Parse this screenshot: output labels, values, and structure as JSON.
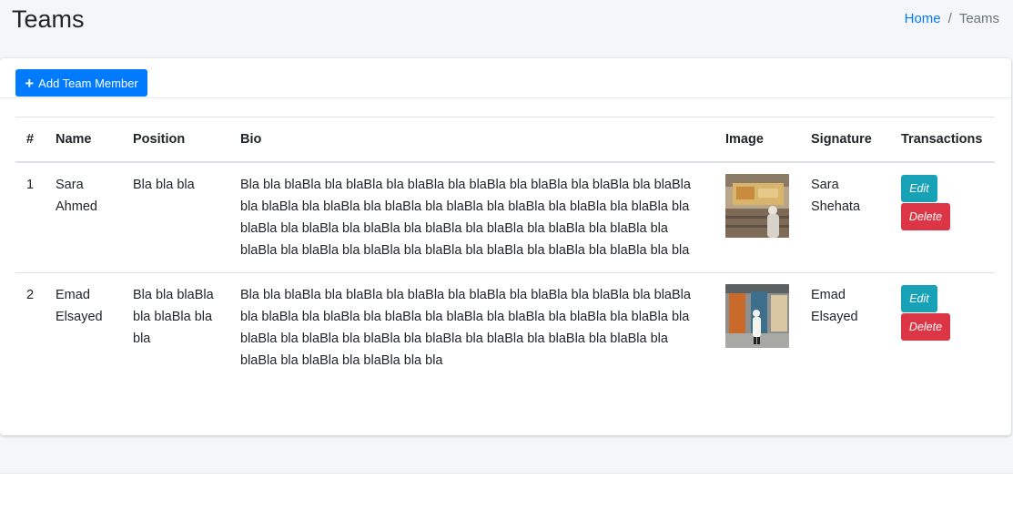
{
  "header": {
    "title": "Teams"
  },
  "breadcrumb": {
    "home": "Home",
    "separator": "/",
    "current": "Teams"
  },
  "toolbar": {
    "add_label": "Add Team Member",
    "accent": "#007bff"
  },
  "table": {
    "columns": [
      "#",
      "Name",
      "Position",
      "Bio",
      "Image",
      "Signature",
      "Transactions"
    ],
    "rows": [
      {
        "index": "1",
        "name": "Sara Ahmed",
        "position": "Bla bla bla",
        "bio": "Bla bla blaBla bla blaBla bla blaBla bla blaBla bla blaBla bla blaBla bla blaBla bla blaBla bla blaBla bla blaBla bla blaBla bla blaBla bla blaBla bla blaBla bla blaBla bla blaBla bla blaBla bla blaBla bla blaBla bla blaBla bla blaBla bla blaBla bla blaBla bla blaBla bla blaBla bla blaBla bla blaBla bla blaBla bla bla",
        "signature": "Sara Shehata",
        "edit_label": "Edit",
        "delete_label": "Delete"
      },
      {
        "index": "2",
        "name": "Emad Elsayed",
        "position": "Bla bla blaBla bla blaBla bla bla",
        "bio": "Bla bla blaBla bla blaBla bla blaBla bla blaBla bla blaBla bla blaBla bla blaBla bla blaBla bla blaBla bla blaBla bla blaBla bla blaBla bla blaBla bla blaBla bla blaBla bla blaBla bla blaBla bla blaBla bla blaBla bla blaBla bla blaBla bla blaBla bla blaBla bla blaBla bla bla",
        "signature": "Emad Elsayed",
        "edit_label": "Edit",
        "delete_label": "Delete"
      }
    ]
  },
  "colors": {
    "edit": "#17a2b8",
    "delete": "#dc3545",
    "link": "#007bff"
  }
}
